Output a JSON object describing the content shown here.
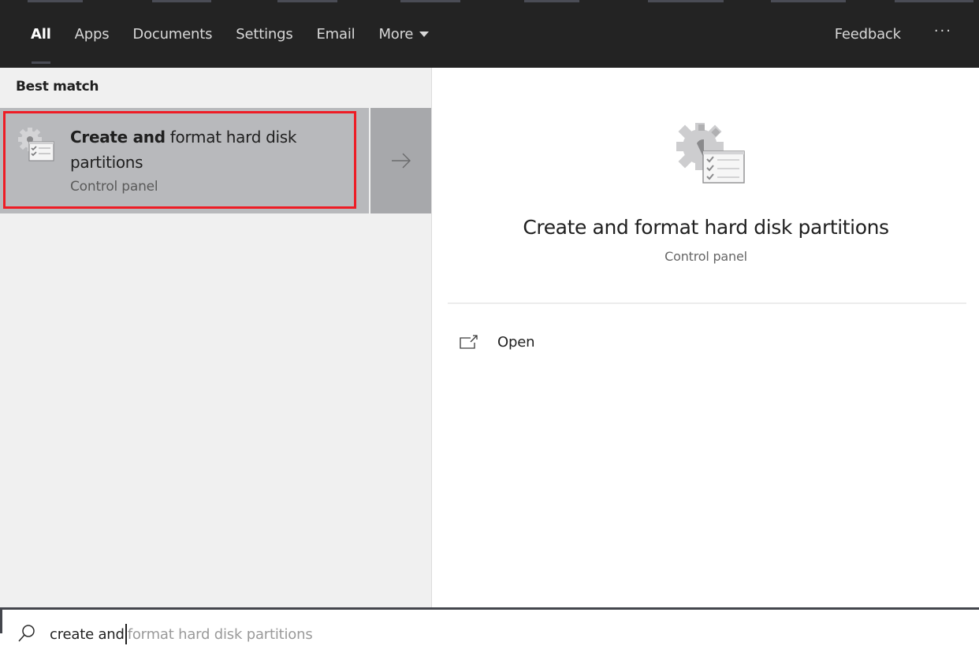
{
  "header": {
    "tabs": [
      {
        "label": "All",
        "active": true
      },
      {
        "label": "Apps",
        "active": false
      },
      {
        "label": "Documents",
        "active": false
      },
      {
        "label": "Settings",
        "active": false
      },
      {
        "label": "Email",
        "active": false
      },
      {
        "label": "More",
        "active": false
      }
    ],
    "feedback_label": "Feedback",
    "more_options_label": "···"
  },
  "results": {
    "section_title": "Best match",
    "best_match": {
      "title_bold": "Create and",
      "title_rest": " format hard disk partitions",
      "subtitle": "Control panel",
      "icon": "control-panel-gear-checklist-icon",
      "highlight_color": "#ee1c25"
    }
  },
  "detail": {
    "title": "Create and format hard disk partitions",
    "subtitle": "Control panel",
    "actions": [
      {
        "label": "Open",
        "icon": "open-external-icon"
      }
    ]
  },
  "search": {
    "typed": "create and",
    "suggestion": "format hard disk partitions"
  }
}
